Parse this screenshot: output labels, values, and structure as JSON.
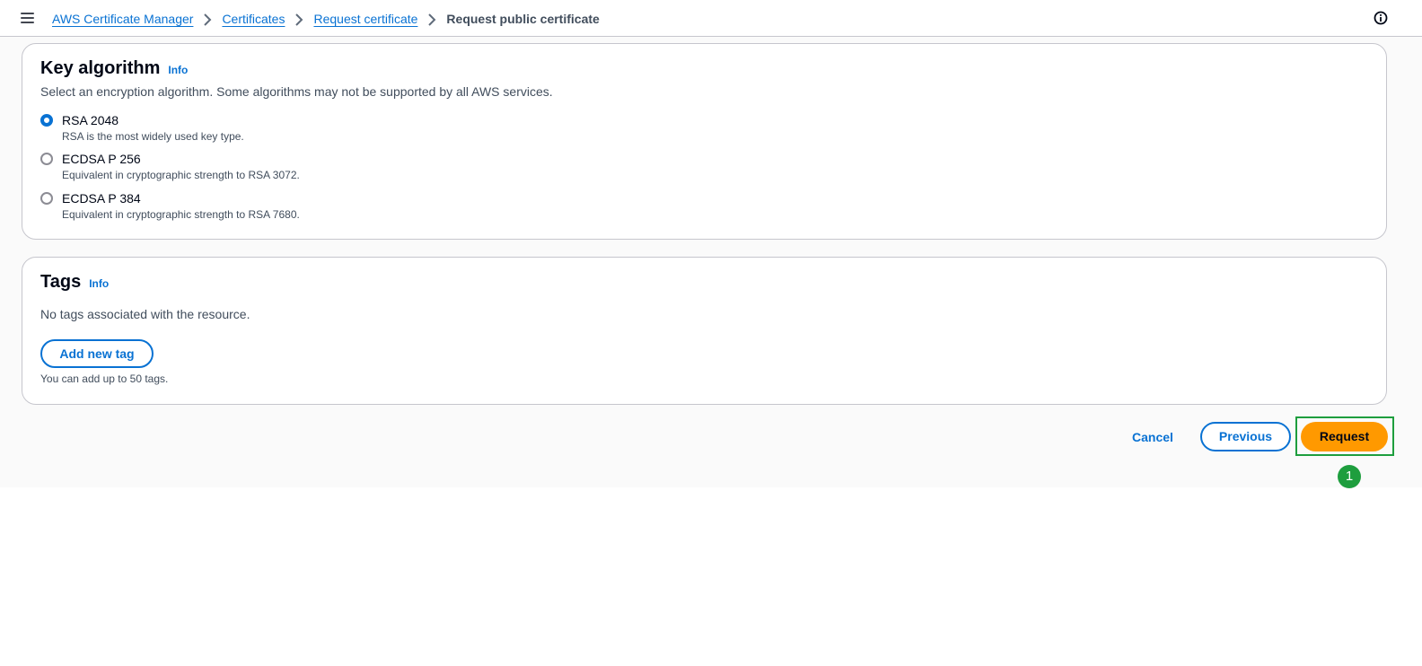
{
  "breadcrumb": {
    "items": [
      "AWS Certificate Manager",
      "Certificates",
      "Request certificate"
    ],
    "current": "Request public certificate"
  },
  "icons": {
    "menu": "hamburger-icon",
    "separator": "chevron-right-icon",
    "help": "info-circle-icon"
  },
  "key_algorithm": {
    "title": "Key algorithm",
    "info": "Info",
    "description": "Select an encryption algorithm. Some algorithms may not be supported by all AWS services.",
    "options": [
      {
        "label": "RSA 2048",
        "description": "RSA is the most widely used key type.",
        "checked": true
      },
      {
        "label": "ECDSA P 256",
        "description": "Equivalent in cryptographic strength to RSA 3072.",
        "checked": false
      },
      {
        "label": "ECDSA P 384",
        "description": "Equivalent in cryptographic strength to RSA 7680.",
        "checked": false
      }
    ]
  },
  "tags": {
    "title": "Tags",
    "info": "Info",
    "empty_text": "No tags associated with the resource.",
    "add_button": "Add new tag",
    "limit_note": "You can add up to 50 tags."
  },
  "actions": {
    "cancel": "Cancel",
    "previous": "Previous",
    "request": "Request"
  },
  "annotation": {
    "step": "1"
  },
  "colors": {
    "link": "#0972d3",
    "primary_button": "#ff9900",
    "highlight": "#1e9e3e"
  }
}
